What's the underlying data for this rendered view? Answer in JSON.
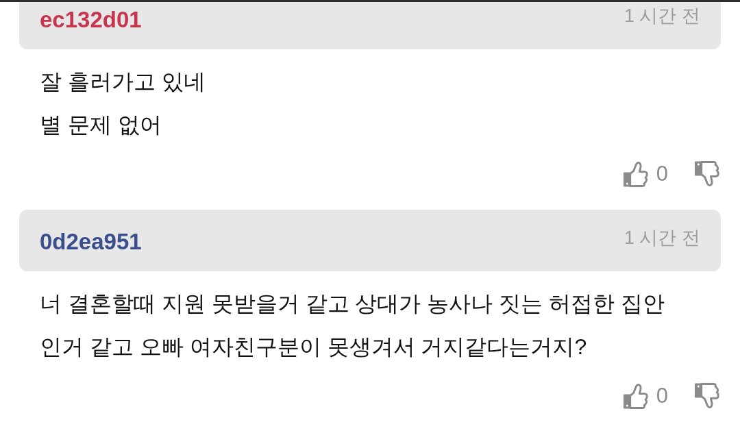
{
  "comments": [
    {
      "author": "ec132d01",
      "color": "#c6354d",
      "time": "1 시간 전",
      "lines": [
        "잘 흘러가고 있네",
        "별 문제 없어"
      ],
      "likes": "0"
    },
    {
      "author": "0d2ea951",
      "color": "#3a4e8e",
      "time": "1 시간 전",
      "lines": [
        "너 결혼할때 지원 못받을거 같고 상대가 농사나 짓는 허접한 집안",
        "인거 같고 오빠 여자친구분이 못생겨서 거지같다는거지?"
      ],
      "likes": "0"
    }
  ]
}
